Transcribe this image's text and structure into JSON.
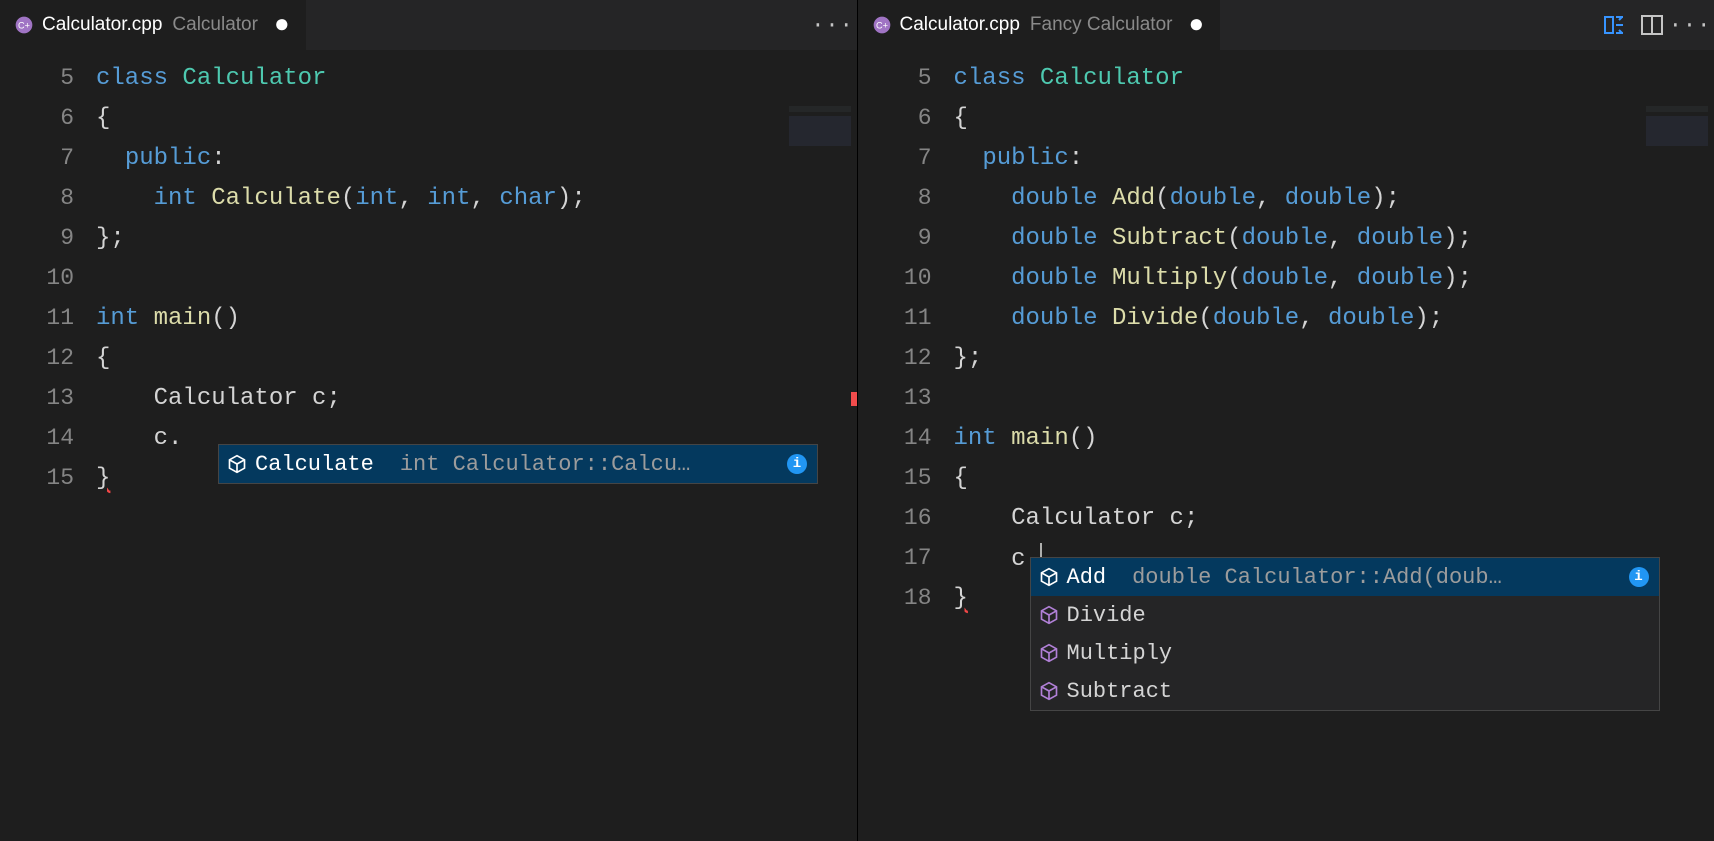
{
  "left": {
    "tab": {
      "filename": "Calculator.cpp",
      "subtitle": "Calculator",
      "dirty": "●"
    },
    "lines": {
      "l5": 5,
      "l6": 6,
      "l7": 7,
      "l8": 8,
      "l9": 9,
      "l10": 10,
      "l11": 11,
      "l12": 12,
      "l13": 13,
      "l14": 14,
      "l15": 15
    },
    "tokens": {
      "class": "class ",
      "Calculator": "Calculator",
      "lbrace": "{",
      "rbrace": "};",
      "rbrace2": "}",
      "public": "public",
      "int": "int ",
      "Calculate": "Calculate",
      "sig": "(",
      "p1": "int",
      "comma": ", ",
      "p2": "int",
      "p3": "char",
      "rp": ");",
      "main": "main",
      "paren": "()",
      "decl": "Calculator c;",
      "cdot": "c."
    },
    "intellisense": {
      "item": "Calculate",
      "detail": "int Calculator::Calcu…"
    }
  },
  "right": {
    "tab": {
      "filename": "Calculator.cpp",
      "subtitle": "Fancy Calculator",
      "dirty": "●"
    },
    "lines": {
      "l5": 5,
      "l6": 6,
      "l7": 7,
      "l8": 8,
      "l9": 9,
      "l10": 10,
      "l11": 11,
      "l12": 12,
      "l13": 13,
      "l14": 14,
      "l15": 15,
      "l16": 16,
      "l17": 17,
      "l18": 18
    },
    "tokens": {
      "class": "class ",
      "Calculator": "Calculator",
      "lbrace": "{",
      "rbrace": "};",
      "rbrace2": "}",
      "public": "public",
      "double": "double ",
      "Add": "Add",
      "Subtract": "Subtract",
      "Multiply": "Multiply",
      "Divide": "Divide",
      "lp": "(",
      "d": "double",
      "c": ", ",
      "rp": ");",
      "int": "int ",
      "main": "main",
      "paren": "()",
      "decl": "Calculator c;",
      "cdot": "c."
    },
    "intellisense": {
      "item0": "Add",
      "detail0": "double Calculator::Add(doub…",
      "item1": "Divide",
      "item2": "Multiply",
      "item3": "Subtract"
    },
    "actions_ellipsis": "···"
  },
  "ellipsis": "···"
}
